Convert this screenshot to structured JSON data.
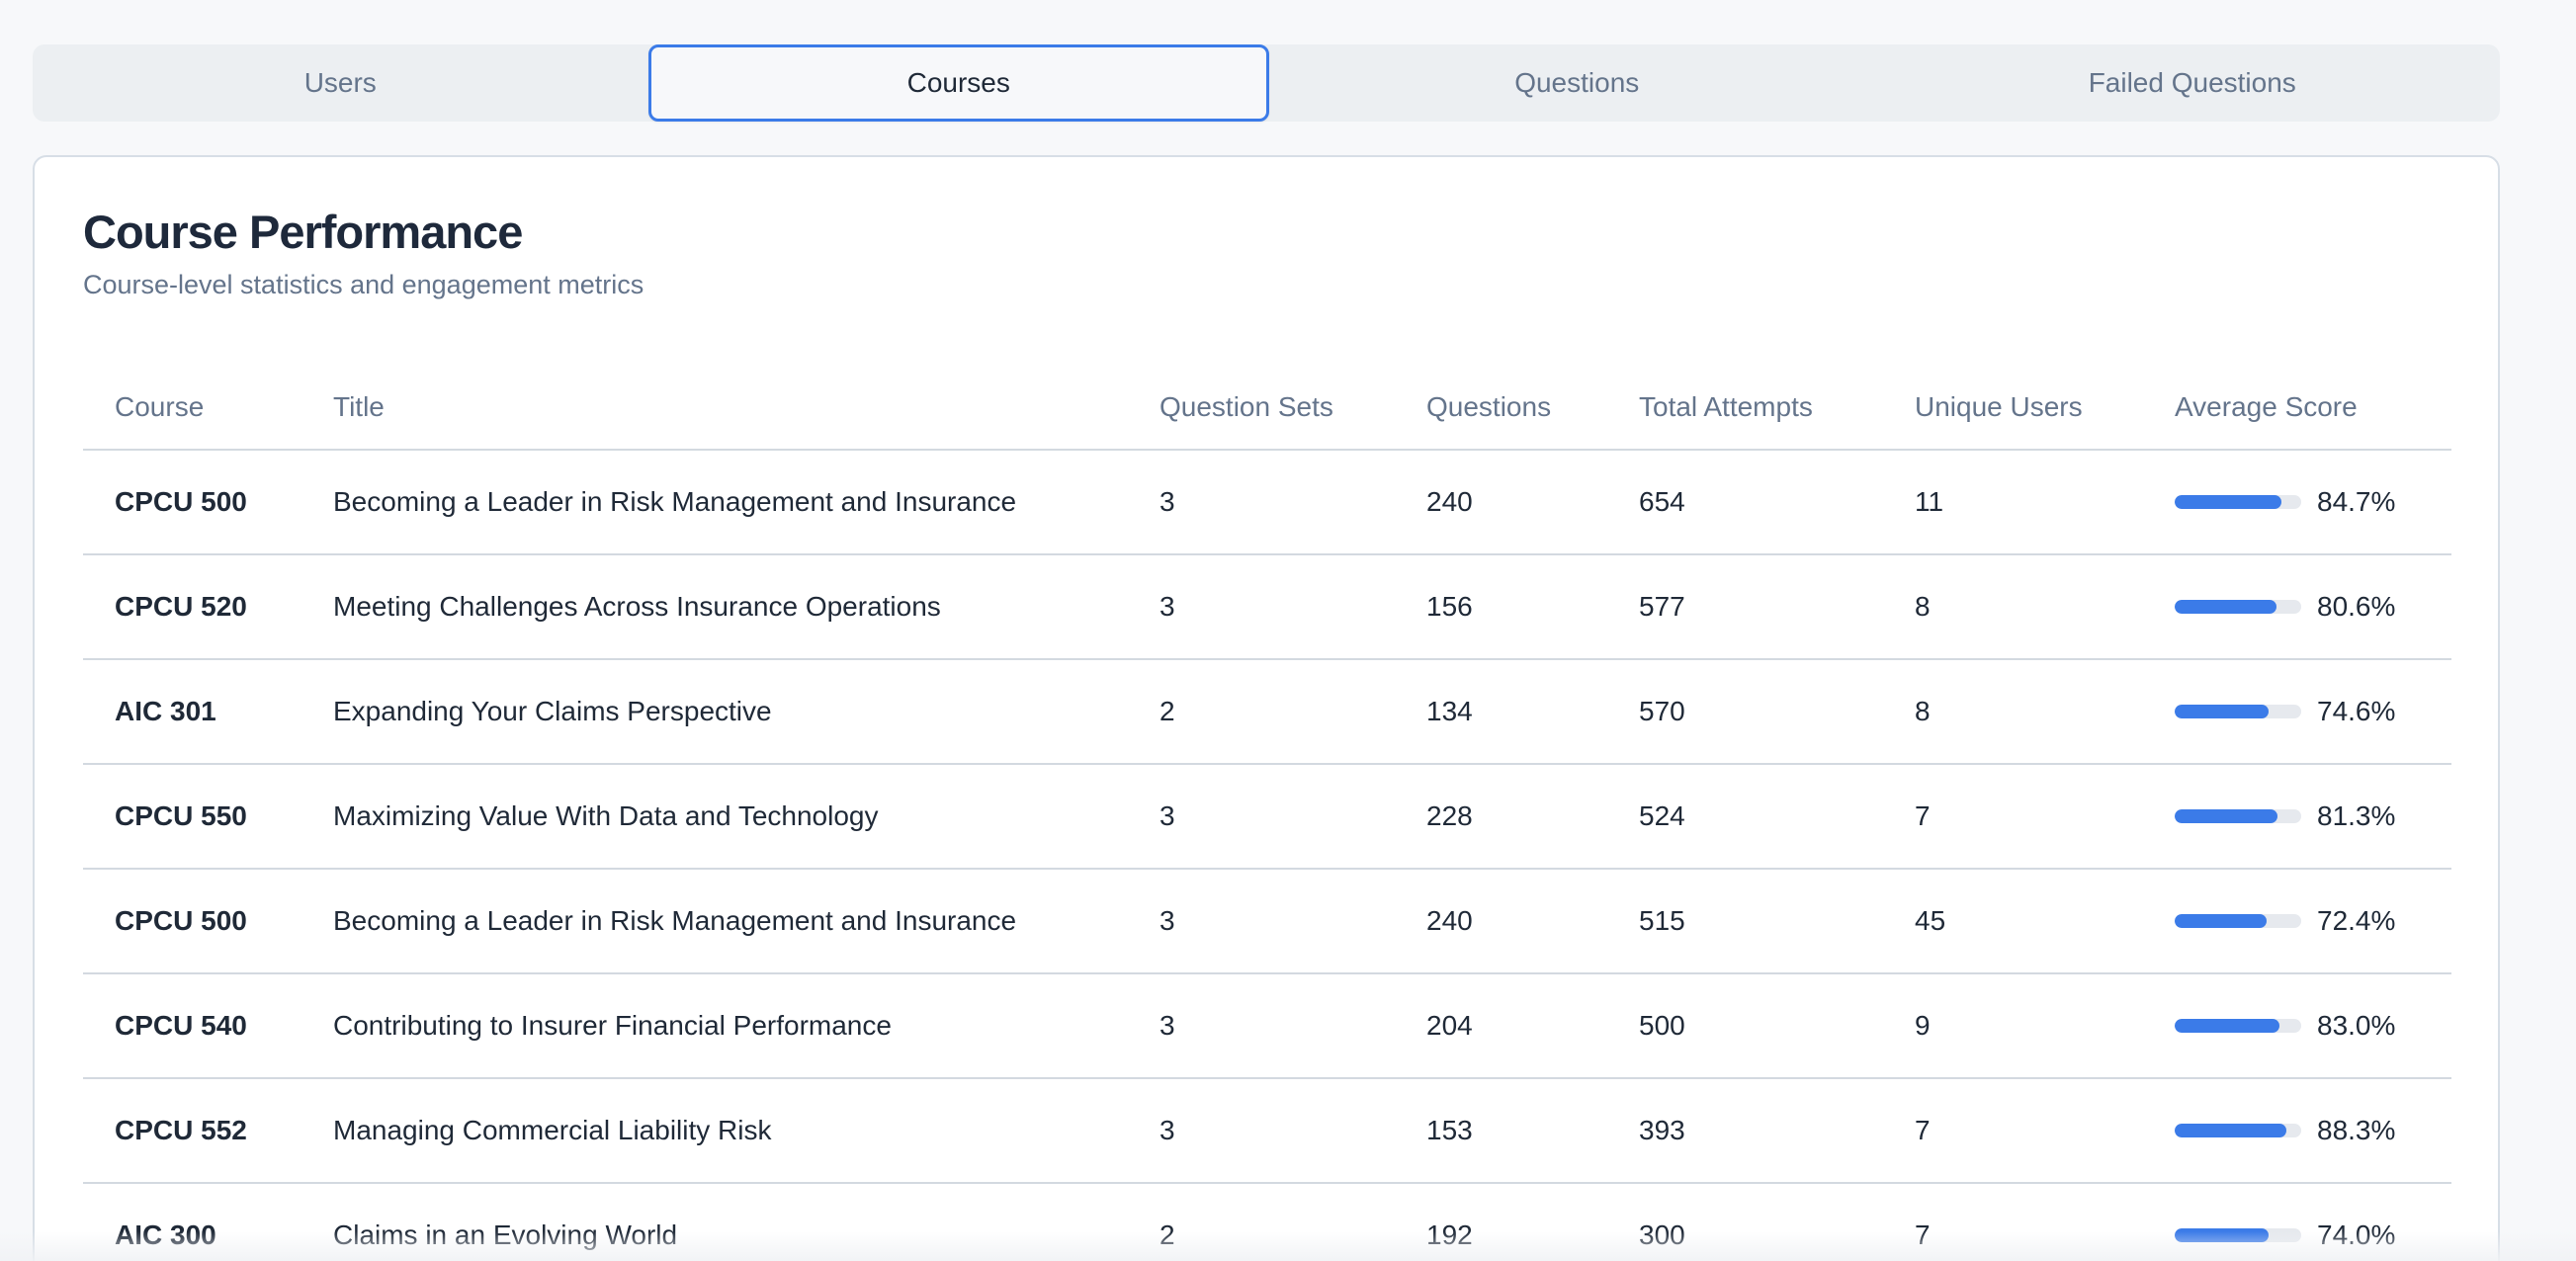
{
  "tabs": [
    {
      "label": "Users",
      "active": false
    },
    {
      "label": "Courses",
      "active": true
    },
    {
      "label": "Questions",
      "active": false
    },
    {
      "label": "Failed Questions",
      "active": false
    }
  ],
  "card": {
    "title": "Course Performance",
    "subtitle": "Course-level statistics and engagement metrics"
  },
  "table": {
    "columns": [
      "Course",
      "Title",
      "Question Sets",
      "Questions",
      "Total Attempts",
      "Unique Users",
      "Average Score"
    ],
    "rows": [
      {
        "course": "CPCU 500",
        "title": "Becoming a Leader in Risk Management and Insurance",
        "question_sets": "3",
        "questions": "240",
        "total_attempts": "654",
        "unique_users": "11",
        "average_score": "84.7%",
        "score_value": 84.7
      },
      {
        "course": "CPCU 520",
        "title": "Meeting Challenges Across Insurance Operations",
        "question_sets": "3",
        "questions": "156",
        "total_attempts": "577",
        "unique_users": "8",
        "average_score": "80.6%",
        "score_value": 80.6
      },
      {
        "course": "AIC 301",
        "title": "Expanding Your Claims Perspective",
        "question_sets": "2",
        "questions": "134",
        "total_attempts": "570",
        "unique_users": "8",
        "average_score": "74.6%",
        "score_value": 74.6
      },
      {
        "course": "CPCU 550",
        "title": "Maximizing Value With Data and Technology",
        "question_sets": "3",
        "questions": "228",
        "total_attempts": "524",
        "unique_users": "7",
        "average_score": "81.3%",
        "score_value": 81.3
      },
      {
        "course": "CPCU 500",
        "title": "Becoming a Leader in Risk Management and Insurance",
        "question_sets": "3",
        "questions": "240",
        "total_attempts": "515",
        "unique_users": "45",
        "average_score": "72.4%",
        "score_value": 72.4
      },
      {
        "course": "CPCU 540",
        "title": "Contributing to Insurer Financial Performance",
        "question_sets": "3",
        "questions": "204",
        "total_attempts": "500",
        "unique_users": "9",
        "average_score": "83.0%",
        "score_value": 83.0
      },
      {
        "course": "CPCU 552",
        "title": "Managing Commercial Liability Risk",
        "question_sets": "3",
        "questions": "153",
        "total_attempts": "393",
        "unique_users": "7",
        "average_score": "88.3%",
        "score_value": 88.3
      },
      {
        "course": "AIC 300",
        "title": "Claims in an Evolving World",
        "question_sets": "2",
        "questions": "192",
        "total_attempts": "300",
        "unique_users": "7",
        "average_score": "74.0%",
        "score_value": 74.0
      }
    ]
  },
  "colors": {
    "accent": "#3b7be8",
    "bar_track": "#e6e9ee",
    "muted_text": "#64748b"
  }
}
